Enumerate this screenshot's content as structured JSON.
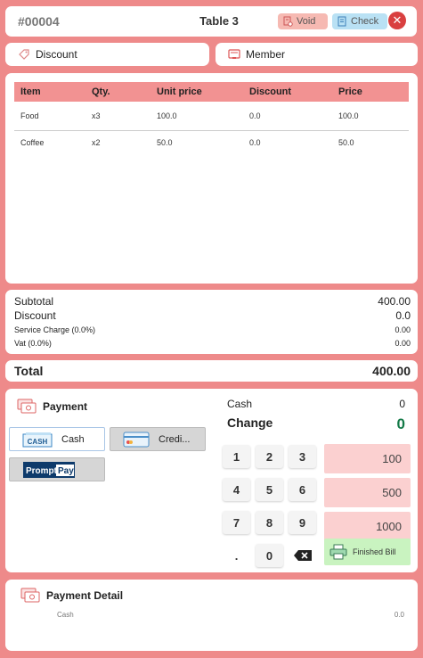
{
  "header": {
    "order_no": "#00004",
    "table": "Table 3",
    "void_label": "Void",
    "check_label": "Check",
    "close_symbol": "✕"
  },
  "discount_label": "Discount",
  "member_label": "Member",
  "items": {
    "columns": [
      "Item",
      "Qty.",
      "Unit price",
      "Discount",
      "Price"
    ],
    "rows": [
      [
        "Food",
        "x3",
        "100.0",
        "0.0",
        "100.0"
      ],
      [
        "Coffee",
        "x2",
        "50.0",
        "0.0",
        "50.0"
      ]
    ]
  },
  "summary": {
    "subtotal_label": "Subtotal",
    "subtotal": "400.00",
    "discount_label": "Discount",
    "discount": "0.0",
    "service_label": "Service Charge (0.0%)",
    "service": "0.00",
    "vat_label": "Vat (0.0%)",
    "vat": "0.00"
  },
  "total": {
    "label": "Total",
    "value": "400.00"
  },
  "payment": {
    "title": "Payment",
    "methods": {
      "cash": "Cash",
      "cash_icon_text": "CASH",
      "credit": "Credi...",
      "promptpay_a": "Prompt",
      "promptpay_b": "Pay"
    },
    "cash_label": "Cash",
    "cash_value": "0",
    "change_label": "Change",
    "change_value": "0",
    "keypad": [
      "1",
      "2",
      "3",
      "4",
      "5",
      "6",
      "7",
      "8",
      "9",
      ".",
      "0"
    ],
    "amounts": [
      "100",
      "500",
      "1000"
    ],
    "finish_label": "Finished Bill"
  },
  "detail": {
    "title": "Payment Detail",
    "cash_label": "Cash",
    "cash_value": "0.0"
  },
  "colors": {
    "background": "#ee8a8a",
    "header_row": "#f29292",
    "void": "#f6b9b2",
    "check": "#b9e1f4",
    "close": "#d94040",
    "change": "#147a48",
    "amount_button": "#fbd0d0",
    "finish_button": "#c9f3c0"
  }
}
